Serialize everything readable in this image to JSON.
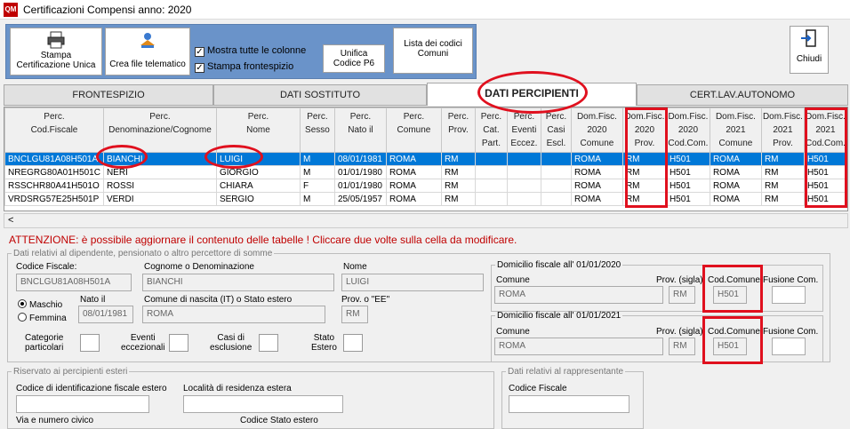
{
  "window": {
    "title": "Certificazioni Compensi anno: 2020",
    "app_icon": "QM"
  },
  "toolbar": {
    "stampa_cu": "Stampa\nCertificazione Unica",
    "crea_file": "Crea file telematico",
    "mostra_colonne": "Mostra tutte le colonne",
    "stampa_frontespizio": "Stampa frontespizio",
    "unifica": "Unifica\nCodice P6",
    "lista_codici": "Lista dei codici\nComuni",
    "chiudi": "Chiudi"
  },
  "tabs": [
    "FRONTESPIZIO",
    "DATI SOSTITUTO",
    "DATI PERCIPIENTI",
    "CERT.LAV.AUTONOMO"
  ],
  "active_tab": "DATI PERCIPIENTI",
  "grid": {
    "headers": [
      "Perc.\nCod.Fiscale",
      "Perc.\nDenominazione/Cognome",
      "Perc.\nNome",
      "Perc.\nSesso",
      "Perc.\nNato il",
      "Perc.\nComune",
      "Perc.\nProv.",
      "Perc.\nCat.\nPart.",
      "Perc.\nEventi\nEccez.",
      "Perc.\nCasi\nEscl.",
      "Dom.Fisc.\n2020\nComune",
      "Dom.Fisc.\n2020\nProv.",
      "Dom.Fisc.\n2020\nCod.Com.",
      "Dom.Fisc.\n2021\nComune",
      "Dom.Fisc.\n2021\nProv.",
      "Dom.Fisc.\n2021\nCod.Com."
    ],
    "rows": [
      [
        "BNCLGU81A08H501A",
        "BIANCHI",
        "LUIGI",
        "M",
        "08/01/1981",
        "ROMA",
        "RM",
        "",
        "",
        "",
        "ROMA",
        "RM",
        "H501",
        "ROMA",
        "RM",
        "H501"
      ],
      [
        "NREGRG80A01H501C",
        "NERI",
        "GIORGIO",
        "M",
        "01/01/1980",
        "ROMA",
        "RM",
        "",
        "",
        "",
        "ROMA",
        "RM",
        "H501",
        "ROMA",
        "RM",
        "H501"
      ],
      [
        "RSSCHR80A41H501O",
        "ROSSI",
        "CHIARA",
        "F",
        "01/01/1980",
        "ROMA",
        "RM",
        "",
        "",
        "",
        "ROMA",
        "RM",
        "H501",
        "ROMA",
        "RM",
        "H501"
      ],
      [
        "VRDSRG57E25H501P",
        "VERDI",
        "SERGIO",
        "M",
        "25/05/1957",
        "ROMA",
        "RM",
        "",
        "",
        "",
        "ROMA",
        "RM",
        "H501",
        "ROMA",
        "RM",
        "H501"
      ]
    ],
    "selected_row": 0,
    "scroll_left": "<"
  },
  "warning": "ATTENZIONE: è possibile aggiornare il contenuto delle tabelle ! Cliccare due volte sulla cella da modificare.",
  "detail": {
    "group_title": "Dati relativi al dipendente, pensionato o altro percettore di somme",
    "codice_fiscale_label": "Codice Fiscale:",
    "codice_fiscale": "BNCLGU81A08H501A",
    "cognome_label": "Cognome o Denominazione",
    "cognome": "BIANCHI",
    "nome_label": "Nome",
    "nome": "LUIGI",
    "maschio": "Maschio",
    "femmina": "Femmina",
    "nato_label": "Nato il",
    "nato": "08/01/1981",
    "comune_nascita_label": "Comune di nascita (IT) o Stato estero",
    "comune_nascita": "ROMA",
    "prov_ee_label": "Prov. o \"EE\"",
    "prov_ee": "RM",
    "categorie": "Categorie\nparticolari",
    "eventi": "Eventi\neccezionali",
    "casi": "Casi di\nesclusione",
    "stato_estero": "Stato\nEstero"
  },
  "dom2020": {
    "title": "Domicilio fiscale all' 01/01/2020",
    "comune_label": "Comune",
    "comune": "ROMA",
    "prov_label": "Prov. (sigla)",
    "prov": "RM",
    "cod_label": "Cod.Comune",
    "cod": "H501",
    "fusione_label": "Fusione Com."
  },
  "dom2021": {
    "title": "Domicilio fiscale all' 01/01/2021",
    "comune_label": "Comune",
    "comune": "ROMA",
    "prov_label": "Prov. (sigla)",
    "prov": "RM",
    "cod_label": "Cod.Comune",
    "cod": "H501",
    "fusione_label": "Fusione Com."
  },
  "esteri": {
    "title": "Riservato ai percipienti esteri",
    "codice_id_label": "Codice di identificazione fiscale estero",
    "localita_label": "Località di residenza estera",
    "via_label": "Via e numero civico",
    "codice_stato_label": "Codice Stato estero"
  },
  "rappresentante": {
    "title": "Dati relativi al rappresentante",
    "codice_fiscale_label": "Codice Fiscale"
  },
  "colors": {
    "selection": "#0078d7",
    "highlight": "#e0101e",
    "toolbar": "#6a93c9",
    "warning": "#c00000"
  }
}
